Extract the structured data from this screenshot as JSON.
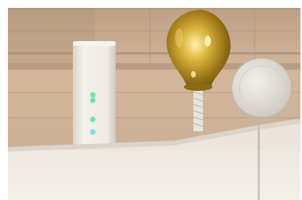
{
  "image": {
    "kind": "photo",
    "border_color": "#ffffff",
    "subjects": [
      "wooden-ceiling",
      "wifi-router",
      "brass-bell-lamp",
      "round-smoke-detector",
      "white-cabinet"
    ],
    "colors": {
      "ceiling": "#c9ac8f",
      "ceiling_shadow": "#a98f78",
      "router_body": "#eee9e2",
      "led_green": "#39e08a",
      "led_cyan": "#3fd8e6",
      "brass": "#c9a22a",
      "detector": "#e6e2dc",
      "cabinet": "#ece6de"
    },
    "router_leds": [
      {
        "color": "green"
      },
      {
        "color": "green"
      },
      {
        "color": "green"
      },
      {
        "color": "cyan"
      }
    ]
  }
}
